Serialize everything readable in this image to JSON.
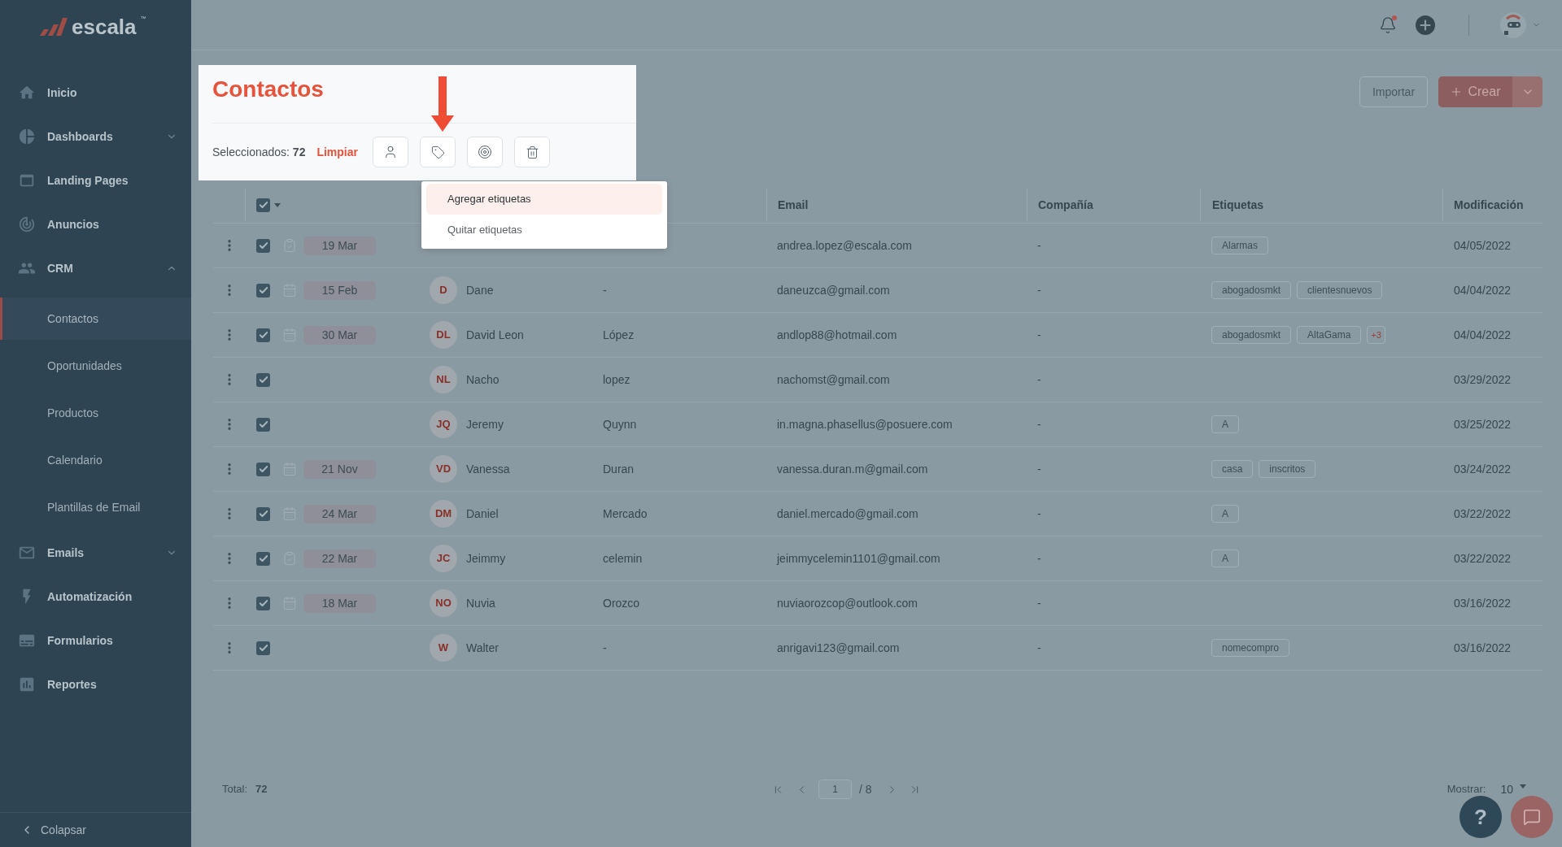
{
  "sidebar": {
    "logo": {
      "text": "escala",
      "mark": "™"
    },
    "items": [
      {
        "label": "Inicio"
      },
      {
        "label": "Dashboards",
        "expanded": false
      },
      {
        "label": "Landing Pages"
      },
      {
        "label": "Anuncios"
      },
      {
        "label": "CRM",
        "expanded": true,
        "children": [
          {
            "label": "Contactos",
            "selected": true
          },
          {
            "label": "Oportunidades",
            "selected": false
          },
          {
            "label": "Productos",
            "selected": false
          },
          {
            "label": "Calendario",
            "selected": false
          },
          {
            "label": "Plantillas de Email",
            "selected": false
          }
        ]
      },
      {
        "label": "Emails",
        "expanded": false
      },
      {
        "label": "Automatización"
      },
      {
        "label": "Formularios"
      },
      {
        "label": "Reportes"
      }
    ],
    "collapse": "Colapsar"
  },
  "top_bar": {
    "notifications": {
      "unread": true
    }
  },
  "page_header": {
    "title": "Contactos",
    "selection": "Seleccionados: **72**",
    "clear": "Limpiar",
    "import": "Importar",
    "create": "Crear"
  },
  "tag_menu": {
    "items": [
      {
        "label": "Agregar etiquetas",
        "selected": true
      },
      {
        "label": "Quitar etiquetas",
        "selected": false
      }
    ]
  },
  "table": {
    "select_all": {
      "checked": true
    },
    "columns": [
      "Email",
      "Compañía",
      "Etiquetas",
      "Modificación"
    ],
    "rows": [
      {
        "checked": true,
        "activity": {
          "kind": "task",
          "date": "19 Mar"
        },
        "email": "andrea.lopez@escala.com",
        "company": "-",
        "tags": [
          {
            "label": "Alarmas"
          }
        ],
        "modified": "04/05/2022"
      },
      {
        "checked": true,
        "activity": {
          "kind": "event",
          "date": "15 Feb"
        },
        "initials": "D",
        "first_name": "Dane",
        "last_name": "-",
        "email": "daneuzca@gmail.com",
        "company": "-",
        "tags": [
          {
            "label": "abogadosmkt"
          },
          {
            "label": "clientesnuevos"
          }
        ],
        "modified": "04/04/2022"
      },
      {
        "checked": true,
        "activity": {
          "kind": "event",
          "date": "30 Mar"
        },
        "initials": "DL",
        "first_name": "David Leon",
        "last_name": "López",
        "email": "andlop88@hotmail.com",
        "company": "-",
        "tags": [
          {
            "label": "abogadosmkt"
          },
          {
            "label": "AltaGama"
          }
        ],
        "more_tags": "+3",
        "modified": "04/04/2022"
      },
      {
        "checked": true,
        "initials": "NL",
        "first_name": "Nacho",
        "last_name": "lopez",
        "email": "nachomst@gmail.com",
        "company": "-",
        "tags": [],
        "modified": "03/29/2022"
      },
      {
        "checked": true,
        "initials": "JQ",
        "first_name": "Jeremy",
        "last_name": "Quynn",
        "email": "in.magna.phasellus@posuere.com",
        "company": "-",
        "tags": [
          {
            "label": "A"
          }
        ],
        "modified": "03/25/2022"
      },
      {
        "checked": true,
        "activity": {
          "kind": "event",
          "date": "21 Nov"
        },
        "initials": "VD",
        "first_name": "Vanessa",
        "last_name": "Duran",
        "email": "vanessa.duran.m@gmail.com",
        "company": "-",
        "tags": [
          {
            "label": "casa"
          },
          {
            "label": "inscritos"
          }
        ],
        "modified": "03/24/2022"
      },
      {
        "checked": true,
        "activity": {
          "kind": "event",
          "date": "24 Mar"
        },
        "initials": "DM",
        "first_name": "Daniel",
        "last_name": "Mercado",
        "email": "daniel.mercado@gmail.com",
        "company": "-",
        "tags": [
          {
            "label": "A"
          }
        ],
        "modified": "03/22/2022"
      },
      {
        "checked": true,
        "activity": {
          "kind": "task",
          "date": "22 Mar"
        },
        "initials": "JC",
        "first_name": "Jeimmy",
        "last_name": "celemin",
        "email": "jeimmycelemin1101@gmail.com",
        "company": "-",
        "tags": [
          {
            "label": "A"
          }
        ],
        "modified": "03/22/2022"
      },
      {
        "checked": true,
        "activity": {
          "kind": "event",
          "date": "18 Mar"
        },
        "initials": "NO",
        "first_name": "Nuvia",
        "last_name": "Orozco",
        "email": "nuviaorozcop@outlook.com",
        "company": "-",
        "tags": [],
        "modified": "03/16/2022"
      },
      {
        "checked": true,
        "initials": "W",
        "first_name": "Walter",
        "last_name": "-",
        "email": "anrigavi123@gmail.com",
        "company": "-",
        "tags": [
          {
            "label": "nomecompro"
          }
        ],
        "modified": "03/16/2022"
      }
    ]
  },
  "footer": {
    "total_label": "Total:",
    "total": "72",
    "page": "1",
    "of_pages": "/ 8",
    "show_label": "Mostrar:",
    "page_size": "10"
  },
  "help": {
    "label": "?"
  }
}
